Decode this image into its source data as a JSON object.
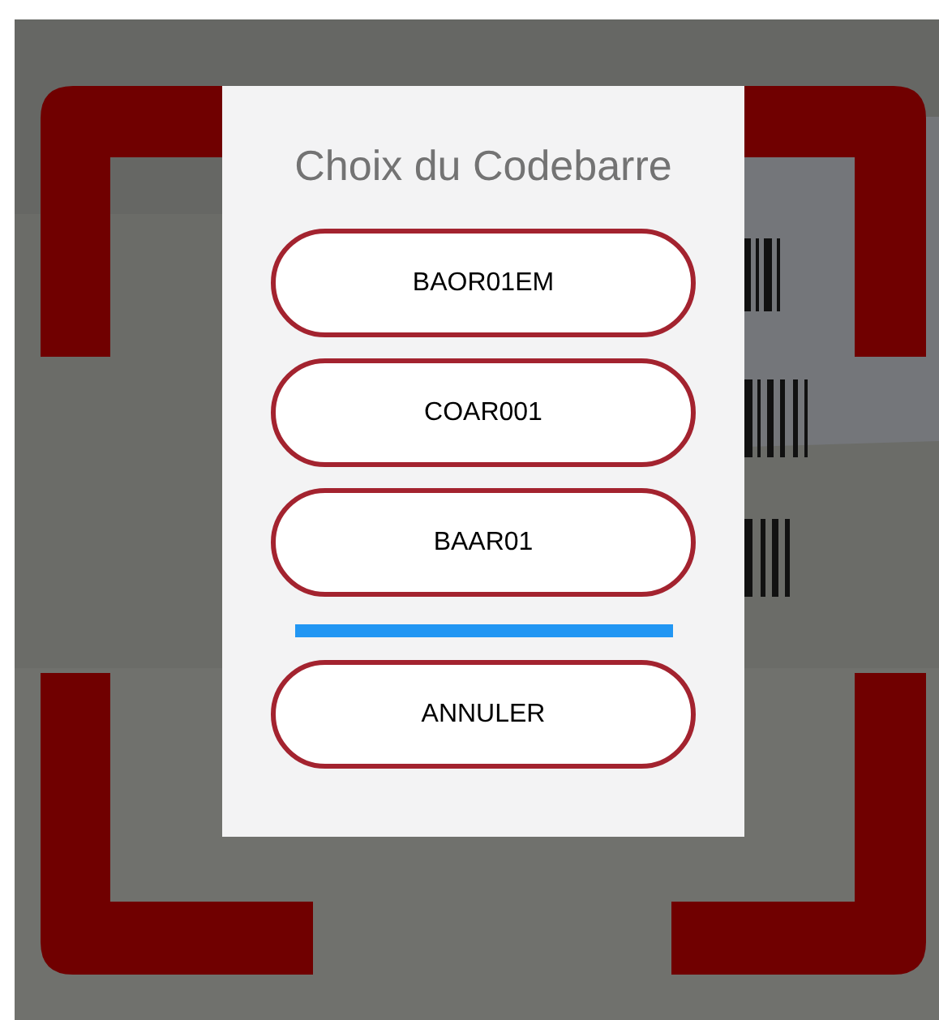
{
  "dialog": {
    "title": "Choix du Codebarre",
    "options": [
      {
        "label": "BAOR01EM"
      },
      {
        "label": "COAR001"
      },
      {
        "label": "BAAR01"
      }
    ],
    "cancel_button": "ANNULER"
  }
}
